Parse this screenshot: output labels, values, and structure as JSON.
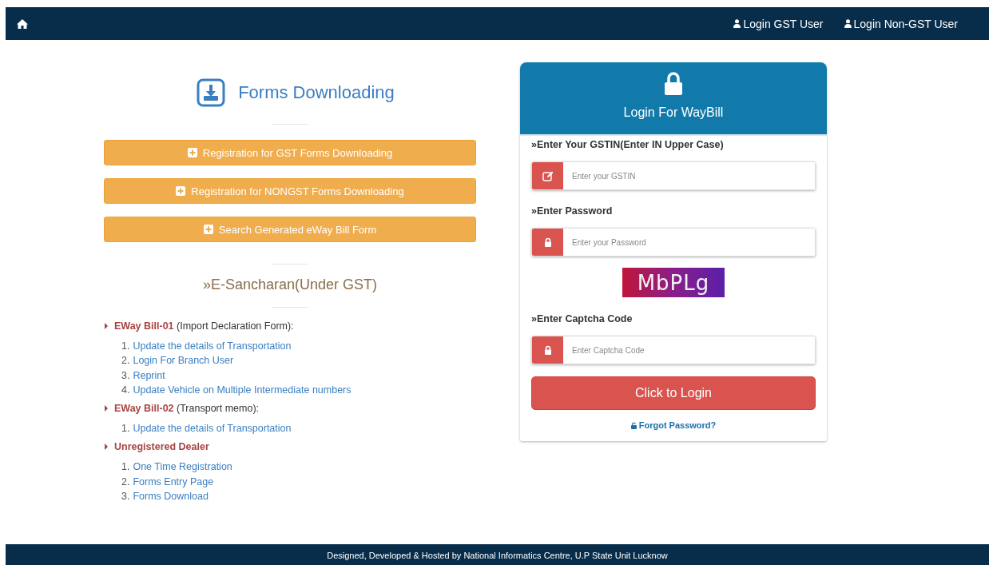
{
  "navbar": {
    "links": [
      {
        "label": "Login GST User"
      },
      {
        "label": "Login Non-GST User"
      }
    ]
  },
  "forms_section": {
    "title": "Forms Downloading",
    "buttons": [
      "Registration for GST Forms Downloading",
      "Registration for NONGST Forms Downloading",
      "Search Generated eWay Bill Form"
    ]
  },
  "sancharan": {
    "title": "»E-Sancharan(Under GST)",
    "groups": [
      {
        "name": "EWay Bill-01",
        "note": " (Import Declaration Form):",
        "links": [
          {
            "number": "1.",
            "label": "Update the details of Transportation"
          },
          {
            "number": "2.",
            "label": "Login For Branch User"
          },
          {
            "number": "3.",
            "label": "Reprint"
          },
          {
            "number": "4.",
            "label": "Update Vehicle on Multiple Intermediate numbers"
          }
        ]
      },
      {
        "name": "EWay Bill-02",
        "note": " (Transport memo):",
        "links": [
          {
            "number": "1.",
            "label": "Update the details of Transportation"
          }
        ]
      },
      {
        "name": "Unregistered Dealer",
        "links": [
          {
            "number": "1.",
            "label": "One Time Registration"
          },
          {
            "number": "2.",
            "label": "Forms Entry Page"
          },
          {
            "number": "3.",
            "label": "Forms Download"
          }
        ]
      }
    ]
  },
  "login_card": {
    "title": "Login For WayBill",
    "fields": [
      {
        "kind": "text",
        "label": "»Enter Your GSTIN(Enter IN Upper Case)",
        "placeholder": "Enter your GSTIN"
      },
      {
        "kind": "secret",
        "label": "»Enter Password",
        "placeholder": "Enter your Password"
      },
      {
        "kind": "captcha",
        "text": "MbPLg"
      },
      {
        "kind": "secret",
        "label": "»Enter Captcha Code",
        "placeholder": "Enter Captcha Code"
      }
    ],
    "submit": "Click to Login",
    "forgot": "Forgot Password?"
  },
  "footer": {
    "text": "Designed, Developed & Hosted by National Informatics Centre, U.P State Unit Lucknow"
  }
}
